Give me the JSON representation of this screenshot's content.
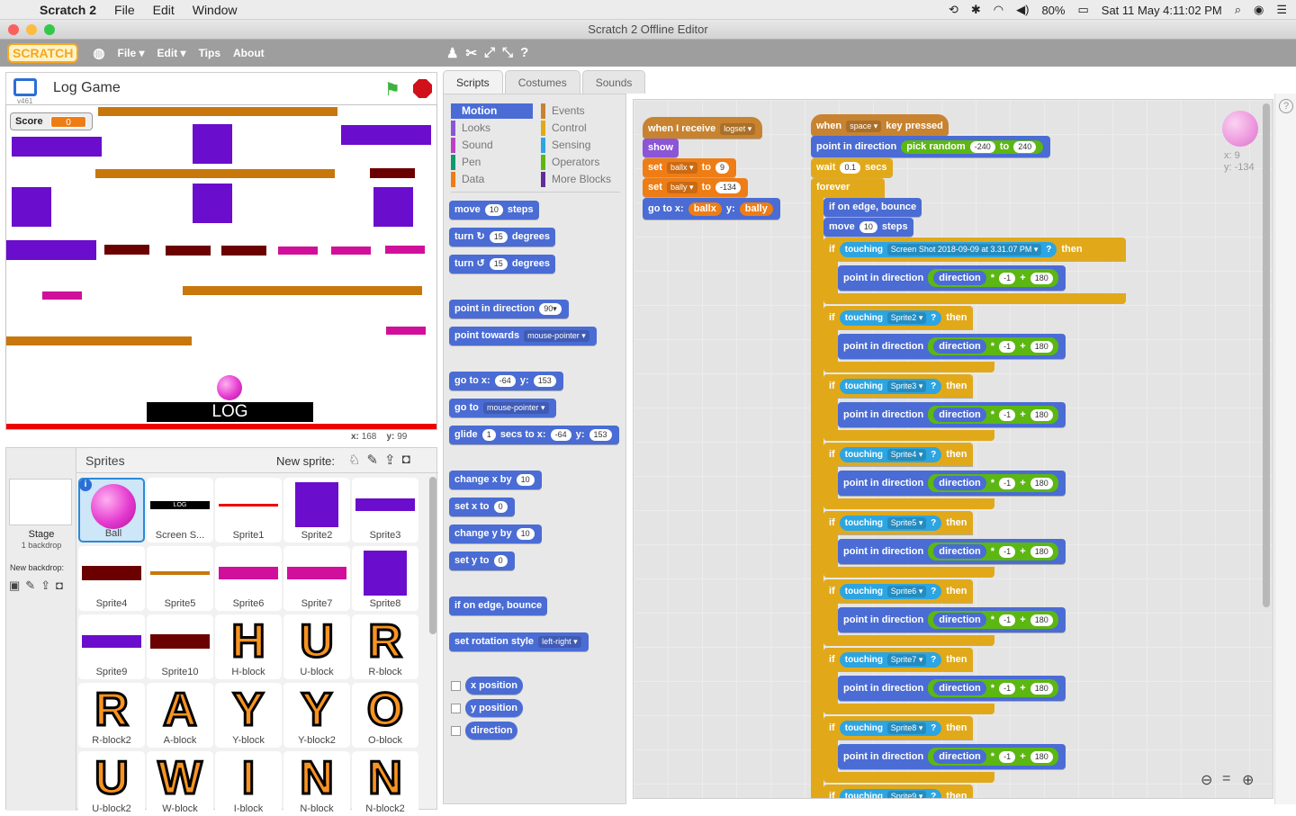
{
  "macos": {
    "app_name": "Scratch 2",
    "menus": [
      "File",
      "Edit",
      "Window"
    ],
    "battery": "80%",
    "datetime": "Sat 11 May  4:11:02 PM"
  },
  "window_title": "Scratch 2 Offline Editor",
  "editor_menu": {
    "logo": "SCRATCH",
    "file": "File ▾",
    "edit": "Edit ▾",
    "tips": "Tips",
    "about": "About"
  },
  "project": {
    "title": "Log Game",
    "version": "v461"
  },
  "stage": {
    "score_label": "Score",
    "score_value": "0",
    "log_label": "LOG",
    "mouse_x_label": "x:",
    "mouse_x": "168",
    "mouse_y_label": "y:",
    "mouse_y": "99"
  },
  "sprites_pane": {
    "title": "Sprites",
    "new_sprite": "New sprite:",
    "stage_label": "Stage",
    "backdrops": "1 backdrop",
    "new_backdrop": "New backdrop:",
    "tiles": [
      {
        "name": "Ball"
      },
      {
        "name": "Screen S..."
      },
      {
        "name": "Sprite1"
      },
      {
        "name": "Sprite2"
      },
      {
        "name": "Sprite3"
      },
      {
        "name": "Sprite4"
      },
      {
        "name": "Sprite5"
      },
      {
        "name": "Sprite6"
      },
      {
        "name": "Sprite7"
      },
      {
        "name": "Sprite8"
      },
      {
        "name": "Sprite9"
      },
      {
        "name": "Sprite10"
      },
      {
        "name": "H-block",
        "letter": "H"
      },
      {
        "name": "U-block",
        "letter": "U"
      },
      {
        "name": "R-block",
        "letter": "R"
      },
      {
        "name": "R-block2",
        "letter": "R"
      },
      {
        "name": "A-block",
        "letter": "A"
      },
      {
        "name": "Y-block",
        "letter": "Y"
      },
      {
        "name": "Y-block2",
        "letter": "Y"
      },
      {
        "name": "O-block",
        "letter": "O"
      },
      {
        "name": "U-block2",
        "letter": "U"
      },
      {
        "name": "W-block",
        "letter": "W"
      },
      {
        "name": "I-block",
        "letter": "I"
      },
      {
        "name": "N-block",
        "letter": "N"
      },
      {
        "name": "N-block2",
        "letter": "N"
      }
    ]
  },
  "tabs": [
    "Scripts",
    "Costumes",
    "Sounds"
  ],
  "categories": {
    "left": [
      "Motion",
      "Looks",
      "Sound",
      "Pen",
      "Data"
    ],
    "right": [
      "Events",
      "Control",
      "Sensing",
      "Operators",
      "More Blocks"
    ]
  },
  "palette": {
    "move": "move",
    "steps": "steps",
    "move_val": "10",
    "turn": "turn",
    "degrees": "degrees",
    "turn_val": "15",
    "point_dir": "point in direction",
    "point_dir_val": "90▾",
    "point_towards": "point towards",
    "mouse_pointer": "mouse-pointer ▾",
    "goto_xy": "go to x:",
    "y": "y:",
    "gx": "-64",
    "gy": "153",
    "goto": "go to",
    "glide": "glide",
    "secs_to_x": "secs to x:",
    "glide_secs": "1",
    "change_x": "change x by",
    "set_x": "set x to",
    "change_y": "change y by",
    "set_y": "set y to",
    "ten": "10",
    "zero": "0",
    "bounce": "if on edge, bounce",
    "rot_style": "set rotation style",
    "left_right": "left-right ▾",
    "x_pos": "x position",
    "y_pos": "y position",
    "direction": "direction"
  },
  "sprite_info": {
    "x_label": "x: 9",
    "y_label": "y: -134"
  },
  "script1": {
    "when_receive": "when I receive",
    "logset": "logset ▾",
    "show": "show",
    "set": "set",
    "to": "to",
    "ballx": "ballx ▾",
    "bally": "bally ▾",
    "ballx_val": "9",
    "bally_val": "-134",
    "goto": "go to x:",
    "y": "y:",
    "ballx_rep": "ballx",
    "bally_rep": "bally"
  },
  "script2": {
    "when": "when",
    "space": "space ▾",
    "key_pressed": "key pressed",
    "point_dir": "point in direction",
    "pick_random": "pick random",
    "to": "to",
    "r1": "-240",
    "r2": "240",
    "wait": "wait",
    "wait_val": "0.1",
    "secs": "secs",
    "forever": "forever",
    "bounce": "if on edge, bounce",
    "move": "move",
    "move_val": "10",
    "steps": "steps",
    "if": "if",
    "touching": "touching",
    "q": "?",
    "then": "then",
    "direction": "direction",
    "times": "*",
    "neg1": "-1",
    "plus": "+",
    "n180": "180",
    "targets": [
      "Screen Shot 2018-09-09 at 3.31.07 PM ▾",
      "Sprite2 ▾",
      "Sprite3 ▾",
      "Sprite4 ▾",
      "Sprite5 ▾",
      "Sprite6 ▾",
      "Sprite7 ▾",
      "Sprite8 ▾",
      "Sprite9 ▾"
    ]
  },
  "colors": {
    "orange": "#c8770c",
    "purple": "#6a0dcc",
    "maroon": "#6b0000",
    "magenta": "#d0109a",
    "red": "#ee0000",
    "black": "#000000",
    "ball": "#e53bd0"
  }
}
